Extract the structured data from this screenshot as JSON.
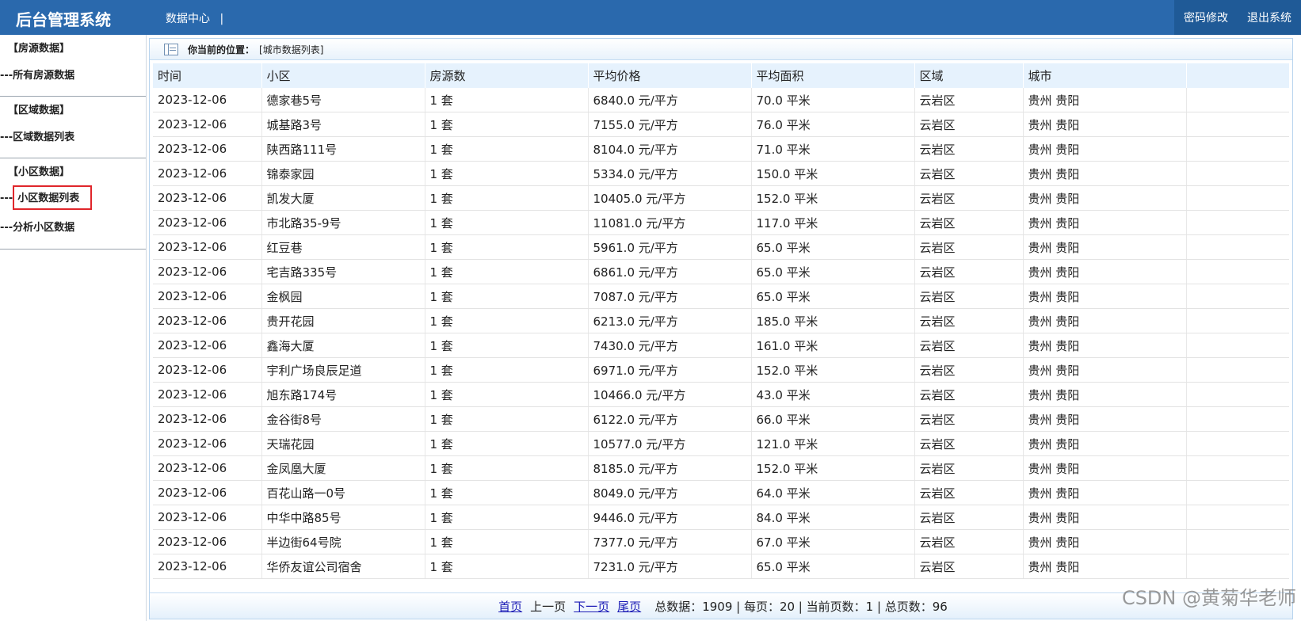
{
  "header": {
    "title": "后台管理系统",
    "nav": "数据中心",
    "nav_sep": "|",
    "change_password": "密码修改",
    "logout": "退出系统"
  },
  "sidebar": {
    "groups": [
      {
        "title": "【房源数据】",
        "items": [
          "---所有房源数据"
        ]
      },
      {
        "title": "【区域数据】",
        "items": [
          "---区域数据列表"
        ]
      },
      {
        "title": "【小区数据】",
        "items": [
          "---",
          "小区数据列表",
          "---分析小区数据"
        ]
      }
    ],
    "active_item": "小区数据列表"
  },
  "breadcrumb": {
    "label": "你当前的位置：",
    "value": "[城市数据列表]"
  },
  "table": {
    "columns": [
      "时间",
      "小区",
      "房源数",
      "平均价格",
      "平均面积",
      "区域",
      "城市"
    ],
    "rows": [
      [
        "2023-12-06",
        "德家巷5号",
        "1 套",
        "6840.0 元/平方",
        "70.0 平米",
        "云岩区",
        "贵州 贵阳"
      ],
      [
        "2023-12-06",
        "城基路3号",
        "1 套",
        "7155.0 元/平方",
        "76.0 平米",
        "云岩区",
        "贵州 贵阳"
      ],
      [
        "2023-12-06",
        "陕西路111号",
        "1 套",
        "8104.0 元/平方",
        "71.0 平米",
        "云岩区",
        "贵州 贵阳"
      ],
      [
        "2023-12-06",
        "锦泰家园",
        "1 套",
        "5334.0 元/平方",
        "150.0 平米",
        "云岩区",
        "贵州 贵阳"
      ],
      [
        "2023-12-06",
        "凯发大厦",
        "1 套",
        "10405.0 元/平方",
        "152.0 平米",
        "云岩区",
        "贵州 贵阳"
      ],
      [
        "2023-12-06",
        "市北路35-9号",
        "1 套",
        "11081.0 元/平方",
        "117.0 平米",
        "云岩区",
        "贵州 贵阳"
      ],
      [
        "2023-12-06",
        "红豆巷",
        "1 套",
        "5961.0 元/平方",
        "65.0 平米",
        "云岩区",
        "贵州 贵阳"
      ],
      [
        "2023-12-06",
        "宅吉路335号",
        "1 套",
        "6861.0 元/平方",
        "65.0 平米",
        "云岩区",
        "贵州 贵阳"
      ],
      [
        "2023-12-06",
        "金枫园",
        "1 套",
        "7087.0 元/平方",
        "65.0 平米",
        "云岩区",
        "贵州 贵阳"
      ],
      [
        "2023-12-06",
        "贵开花园",
        "1 套",
        "6213.0 元/平方",
        "185.0 平米",
        "云岩区",
        "贵州 贵阳"
      ],
      [
        "2023-12-06",
        "鑫海大厦",
        "1 套",
        "7430.0 元/平方",
        "161.0 平米",
        "云岩区",
        "贵州 贵阳"
      ],
      [
        "2023-12-06",
        "宇利广场良辰足道",
        "1 套",
        "6971.0 元/平方",
        "152.0 平米",
        "云岩区",
        "贵州 贵阳"
      ],
      [
        "2023-12-06",
        "旭东路174号",
        "1 套",
        "10466.0 元/平方",
        "43.0 平米",
        "云岩区",
        "贵州 贵阳"
      ],
      [
        "2023-12-06",
        "金谷街8号",
        "1 套",
        "6122.0 元/平方",
        "66.0 平米",
        "云岩区",
        "贵州 贵阳"
      ],
      [
        "2023-12-06",
        "天瑞花园",
        "1 套",
        "10577.0 元/平方",
        "121.0 平米",
        "云岩区",
        "贵州 贵阳"
      ],
      [
        "2023-12-06",
        "金凤凰大厦",
        "1 套",
        "8185.0 元/平方",
        "152.0 平米",
        "云岩区",
        "贵州 贵阳"
      ],
      [
        "2023-12-06",
        "百花山路一0号",
        "1 套",
        "8049.0 元/平方",
        "64.0 平米",
        "云岩区",
        "贵州 贵阳"
      ],
      [
        "2023-12-06",
        "中华中路85号",
        "1 套",
        "9446.0 元/平方",
        "84.0 平米",
        "云岩区",
        "贵州 贵阳"
      ],
      [
        "2023-12-06",
        "半边街64号院",
        "1 套",
        "7377.0 元/平方",
        "67.0 平米",
        "云岩区",
        "贵州 贵阳"
      ],
      [
        "2023-12-06",
        "华侨友谊公司宿舍",
        "1 套",
        "7231.0 元/平方",
        "65.0 平米",
        "云岩区",
        "贵州 贵阳"
      ]
    ]
  },
  "pager": {
    "first": "首页",
    "prev": "上一页",
    "next": "下一页",
    "last": "尾页",
    "info": "总数据：1909 | 每页：20 | 当前页数：1 | 总页数：96"
  },
  "watermark": "CSDN @黄菊华老师",
  "colors": {
    "topbar": "#2a69ad",
    "header_row": "#e6f2fd",
    "highlight_border": "#e0262b",
    "link": "#1a1ab5"
  }
}
